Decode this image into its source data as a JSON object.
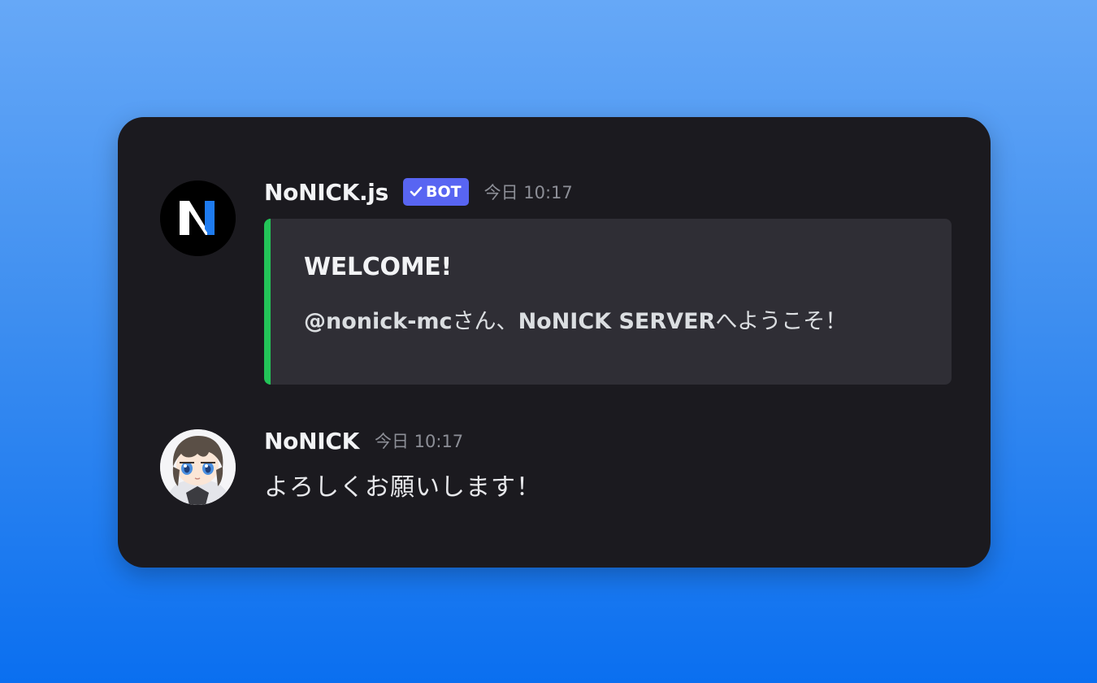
{
  "messages": [
    {
      "author": "NoNICK.js",
      "bot_tag": "BOT",
      "timestamp": "今日 10:17",
      "avatar_icon": "nonick-logo-icon",
      "embed": {
        "accent_color": "#23c458",
        "title": "WELCOME!",
        "mention": "@nonick-mc",
        "text_after_mention": "さん、",
        "server_name": "NoNICK SERVER",
        "text_end": "へようこそ！"
      }
    },
    {
      "author": "NoNICK",
      "timestamp": "今日 10:17",
      "avatar_icon": "user-avatar-icon",
      "text": "よろしくお願いします！"
    }
  ],
  "colors": {
    "card_background": "#1b1a1f",
    "embed_background": "#2f2e35",
    "bot_tag": "#5865f2",
    "logo_accent": "#1e7bf0"
  }
}
